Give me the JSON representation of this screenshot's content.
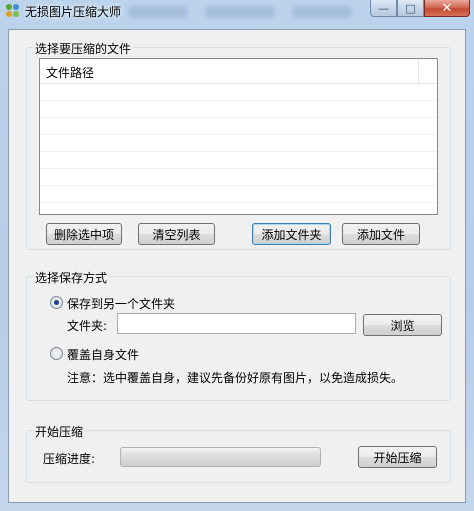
{
  "window": {
    "title": "无损图片压缩大师",
    "controls": {
      "minimize": "—",
      "maximize": "□",
      "close": "✕"
    }
  },
  "files_group": {
    "label": "选择要压缩的文件",
    "list": {
      "columns": [
        "文件路径"
      ],
      "rows": []
    },
    "buttons": {
      "delete_selected": "删除选中项",
      "clear_list": "清空列表",
      "add_folder": "添加文件夹",
      "add_file": "添加文件"
    }
  },
  "save_group": {
    "label": "选择保存方式",
    "option_folder": {
      "label": "保存到另一个文件夹",
      "checked": true
    },
    "folder_label": "文件夹:",
    "folder_value": "",
    "browse_button": "浏览",
    "option_overwrite": {
      "label": "覆盖自身文件",
      "checked": false
    },
    "note": "注意：选中覆盖自身，建议先备份好原有图片，以免造成损失。"
  },
  "start_group": {
    "label": "开始压缩",
    "progress_label": "压缩进度:",
    "progress_value": 0,
    "start_button": "开始压缩"
  },
  "colors": {
    "window_frame": "#bcd3ec",
    "client_bg": "#f0f0f0",
    "close_button": "#c24a33",
    "radio_dot": "#1e3f8a"
  }
}
